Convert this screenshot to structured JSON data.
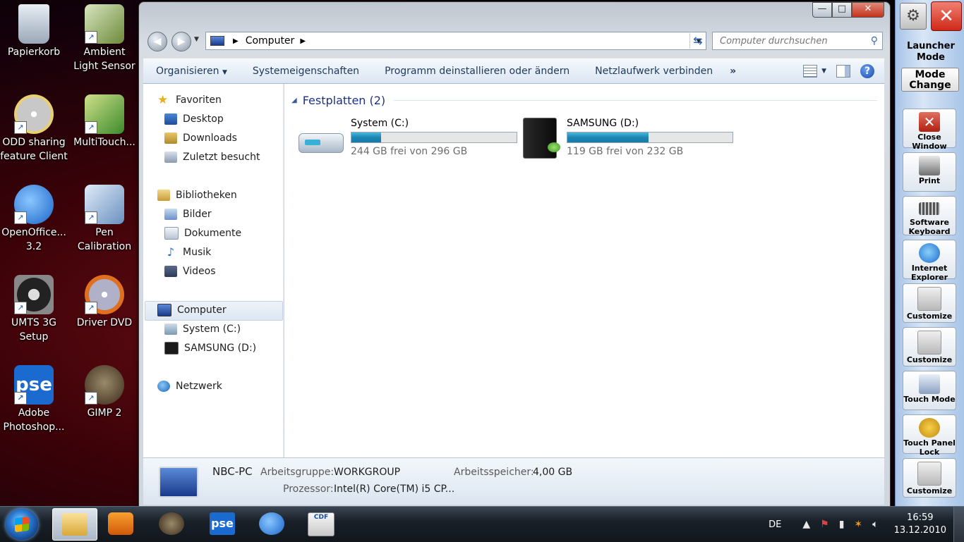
{
  "desktop": {
    "icons": [
      {
        "label": "Papierkorb",
        "icon": "recycle-bin-icon"
      },
      {
        "label": "Ambient Light Sensor",
        "icon": "ambient-light-icon"
      },
      {
        "label": "ODD sharing feature Client",
        "icon": "odd-sharing-icon"
      },
      {
        "label": "MultiTouch...",
        "icon": "multitouch-icon"
      },
      {
        "label": "OpenOffice... 3.2",
        "icon": "openoffice-icon"
      },
      {
        "label": "Pen Calibration",
        "icon": "pen-calibration-icon"
      },
      {
        "label": "UMTS 3G Setup",
        "icon": "umts-icon"
      },
      {
        "label": "Driver DVD",
        "icon": "dvd-icon"
      },
      {
        "label": "Adobe Photoshop...",
        "icon": "photoshop-icon",
        "glyph": "pse"
      },
      {
        "label": "GIMP 2",
        "icon": "gimp-icon"
      }
    ]
  },
  "explorer": {
    "window_buttons": {
      "minimize": "—",
      "maximize": "□",
      "close": "✕"
    },
    "address": {
      "location": "Computer"
    },
    "search": {
      "placeholder": "Computer durchsuchen"
    },
    "toolbar": {
      "organize": "Organisieren",
      "system_properties": "Systemeigenschaften",
      "uninstall": "Programm deinstallieren oder ändern",
      "map_drive": "Netzlaufwerk verbinden",
      "more": "»"
    },
    "nav": {
      "favorites": "Favoriten",
      "desktop": "Desktop",
      "downloads": "Downloads",
      "recent": "Zuletzt besucht",
      "libraries": "Bibliotheken",
      "pictures": "Bilder",
      "documents": "Dokumente",
      "music": "Musik",
      "videos": "Videos",
      "computer": "Computer",
      "drive_c": "System (C:)",
      "drive_d": "SAMSUNG (D:)",
      "network": "Netzwerk"
    },
    "group": {
      "title": "Festplatten (2)"
    },
    "drives": [
      {
        "name": "System (C:)",
        "free": "244 GB frei von 296 GB",
        "used_fraction": 0.18
      },
      {
        "name": "SAMSUNG (D:)",
        "free": "119 GB frei von 232 GB",
        "used_fraction": 0.49
      }
    ],
    "details": {
      "pc_name": "NBC-PC",
      "workgroup_label": "Arbeitsgruppe:",
      "workgroup_value": "WORKGROUP",
      "memory_label": "Arbeitsspeicher:",
      "memory_value": "4,00 GB",
      "cpu_label": "Prozessor:",
      "cpu_value": "Intel(R) Core(TM) i5 CP..."
    }
  },
  "launcher": {
    "mode_title": "Launcher Mode",
    "mode_change": "Mode Change",
    "buttons": [
      {
        "label": "Close Window",
        "icon": "close-window-icon"
      },
      {
        "label": "Print",
        "icon": "printer-icon"
      },
      {
        "label": "Software Keyboard",
        "icon": "keyboard-icon"
      },
      {
        "label": "Internet Explorer",
        "icon": "internet-explorer-icon"
      },
      {
        "label": "Customize",
        "icon": "customize-icon"
      },
      {
        "label": "Customize",
        "icon": "customize-icon"
      },
      {
        "label": "Touch Mode",
        "icon": "touch-mode-icon"
      },
      {
        "label": "Touch Panel Lock",
        "icon": "lock-icon"
      },
      {
        "label": "Customize",
        "icon": "customize-icon"
      }
    ]
  },
  "taskbar": {
    "language": "DE",
    "time": "16:59",
    "date": "13.12.2010",
    "pse_glyph": "pse",
    "cdf_glyph": "CDF"
  },
  "colors": {
    "link_blue": "#1e395b",
    "group_header": "#1e3287",
    "drive_bar": "#1b86b4",
    "close_red": "#d02818"
  }
}
